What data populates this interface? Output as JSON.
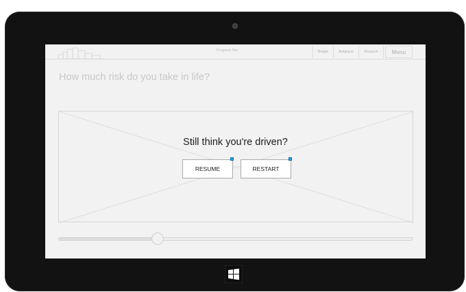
{
  "header": {
    "progress_label": "Progress Bar",
    "languages": [
      "België",
      "Belgique",
      "Deutsch"
    ],
    "menu_label": "Menu"
  },
  "main": {
    "question": "How much risk do you take in life?"
  },
  "dialog": {
    "title": "Still think you're driven?",
    "resume_label": "RESUME",
    "restart_label": "RESTART"
  },
  "slider": {
    "value_fraction": 0.28
  },
  "icons": {
    "windows": "windows-logo-icon",
    "camera": "camera-icon",
    "logo": "city-skyline-logo-icon",
    "placeholder": "image-placeholder-icon",
    "marker": "selection-marker-icon"
  },
  "colors": {
    "marker": "#29a3e0",
    "device": "#121212",
    "screen": "#f2f2f2"
  }
}
